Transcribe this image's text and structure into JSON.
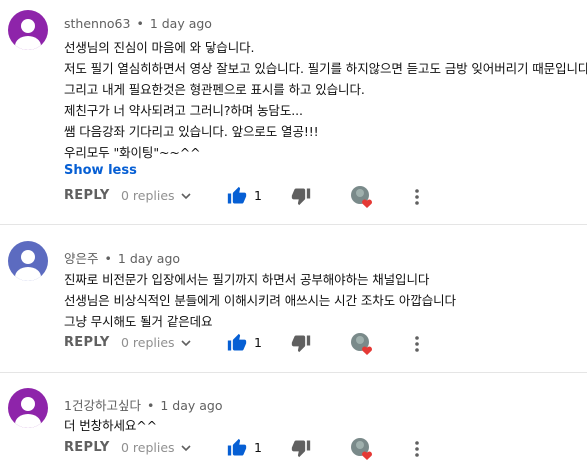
{
  "colors": {
    "link": "#065fd4",
    "like_active": "#065fd4",
    "heart": "#e53935",
    "avatar_purple": "#8e24aa",
    "avatar_blue": "#5c6bc0"
  },
  "common": {
    "reply_label": "REPLY",
    "replies_label": "0 replies",
    "like_count": "1",
    "separator": "•"
  },
  "comments": [
    {
      "author": "sthenno63",
      "time": "1 day ago",
      "avatar_color": "purple",
      "lines": [
        "선생님의 진심이 마음에 와  닿습니다.",
        "저도 필기 열심히하면서 영상 잘보고 있습니다. 필기를 하지않으면 듣고도 금방 잊어버리기 때문입니다.",
        "그리고 내게 필요한것은 형관펜으로 표시를 하고 있습니다.",
        "제친구가 너 약사되려고 그러니?하며 농담도...",
        "쌤 다음강좌 기다리고 있습니다. 앞으로도 열공!!!",
        "우리모두 \"화이팅\"~~^^"
      ],
      "show_less": "Show less"
    },
    {
      "author": "양은주",
      "time": "1 day ago",
      "avatar_color": "blue",
      "lines": [
        "진짜로 비전문가 입장에서는 필기까지  하면서 공부해야하는 채널입니다",
        "선생님은 비상식적인 분들에게 이해시키려 애쓰시는 시간 조차도 아깝습니다",
        "그냥 무시해도 될거 같은데요"
      ]
    },
    {
      "author": "1건강하고싶다",
      "time": "1 day ago",
      "avatar_color": "purple",
      "lines": [
        "더 번창하세요^^"
      ]
    }
  ]
}
